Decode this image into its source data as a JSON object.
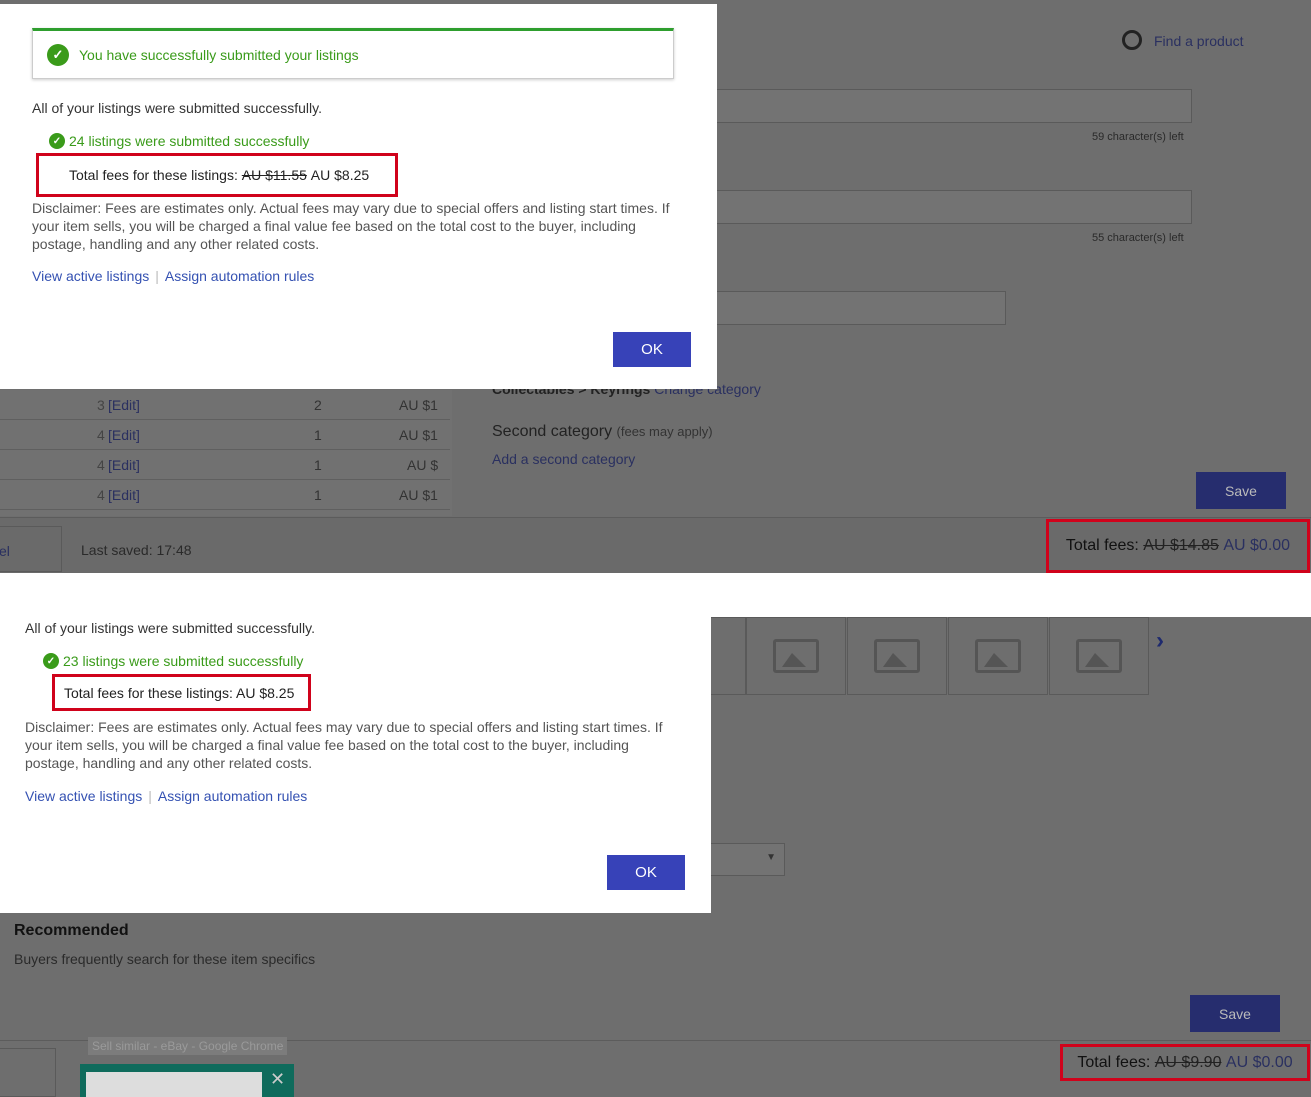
{
  "top": {
    "banner": "You have successfully submitted your listings",
    "summary": "All of your listings were submitted successfully.",
    "count_text": "24 listings were submitted successfully",
    "fees_label": "Total fees for these listings:",
    "fees_old": "AU $11.55",
    "fees_new": "AU $8.25",
    "disclaimer": "Disclaimer: Fees are estimates only. Actual fees may vary due to special offers and listing start times. If your item sells, you will be charged a final value fee based on the total cost to the buyer, including postage, handling and any other related costs.",
    "link_active": "View active listings",
    "link_rules": "Assign automation rules",
    "ok": "OK",
    "find_product": "Find a product",
    "chars_left_1": "59 character(s) left",
    "chars_left_2": "55 character(s) left",
    "category": "Collectables > Keyrings",
    "change_category": "Change category",
    "second_category": "Second category",
    "fees_may_apply": "(fees may apply)",
    "add_second": "Add a second category",
    "rows": [
      {
        "qty": "3",
        "edit": "[Edit]",
        "num": "2",
        "price": "AU $1"
      },
      {
        "qty": "4",
        "edit": "[Edit]",
        "num": "1",
        "price": "AU $1"
      },
      {
        "qty": "4",
        "edit": "[Edit]",
        "num": "1",
        "price": "AU $"
      },
      {
        "qty": "4",
        "edit": "[Edit]",
        "num": "1",
        "price": "AU $1"
      }
    ],
    "save": "Save",
    "cancel_partial": "el",
    "last_saved": "Last saved: 17:48",
    "total_label": "Total fees:",
    "total_old": "AU $14.85",
    "total_new": "AU $0.00"
  },
  "bottom": {
    "summary": "All of your listings were submitted successfully.",
    "count_text": "23 listings were submitted successfully",
    "fees_text": "Total fees for these listings: AU $8.25",
    "disclaimer": "Disclaimer: Fees are estimates only. Actual fees may vary due to special offers and listing start times. If your item sells, you will be charged a final value fee based on the total cost to the buyer, including postage, handling and any other related costs.",
    "link_active": "View active listings",
    "link_rules": "Assign automation rules",
    "ok": "OK",
    "recommended": "Recommended",
    "recommended_sub": "Buyers frequently search for these item specifics",
    "save": "Save",
    "taskbar_tooltip": "Sell similar - eBay - Google Chrome",
    "total_label": "Total fees:",
    "total_old": "AU $9.90",
    "total_new": "AU $0.00"
  },
  "colors": {
    "accent": "#3742b8",
    "success": "#3a9b1a",
    "highlight": "#d0021b"
  }
}
